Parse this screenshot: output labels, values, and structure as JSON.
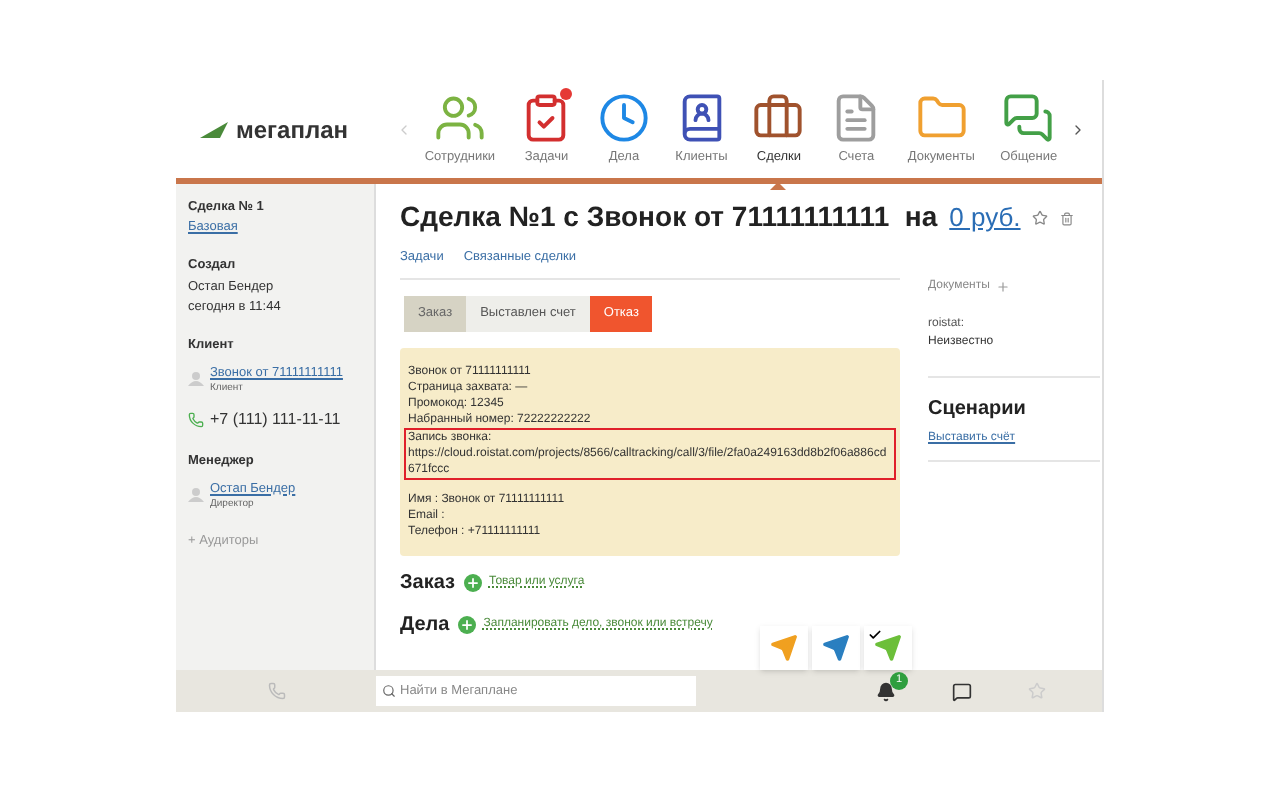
{
  "logo": {
    "text": "мегаплан"
  },
  "nav": [
    {
      "kind": "staff",
      "label": "Сотрудники",
      "selected": false,
      "alert": false
    },
    {
      "kind": "tasks",
      "label": "Задачи",
      "selected": false,
      "alert": true
    },
    {
      "kind": "clock",
      "label": "Дела",
      "selected": false,
      "alert": false
    },
    {
      "kind": "contacts",
      "label": "Клиенты",
      "selected": false,
      "alert": false
    },
    {
      "kind": "deals",
      "label": "Сделки",
      "selected": true,
      "alert": false
    },
    {
      "kind": "invoice",
      "label": "Счета",
      "selected": false,
      "alert": false
    },
    {
      "kind": "folder",
      "label": "Документы",
      "selected": false,
      "alert": false
    },
    {
      "kind": "chat",
      "label": "Общение",
      "selected": false,
      "alert": false
    }
  ],
  "sidebar": {
    "deal_title": "Сделка № 1",
    "deal_type": "Базовая",
    "created_label": "Создал",
    "created_by": "Остап Бендер",
    "created_at": "сегодня в 11:44",
    "client_label": "Клиент",
    "client_name": "Звонок от 71111111111",
    "client_role": "Клиент",
    "client_phone": "+7 (111) 111-11-11",
    "manager_label": "Менеджер",
    "manager_name": "Остап Бендер",
    "manager_role": "Директор",
    "auditors": "+ Аудиторы"
  },
  "deal": {
    "title": "Сделка №1 с Звонок от 71111111111  на",
    "amount": "0 руб."
  },
  "tabs": [
    {
      "label": "Задачи"
    },
    {
      "label": "Связанные сделки"
    }
  ],
  "stages": [
    {
      "label": "Заказ",
      "done": true,
      "selected": false
    },
    {
      "label": "Выставлен счет",
      "done": false,
      "selected": false
    },
    {
      "label": "Отказ",
      "done": false,
      "selected": true
    }
  ],
  "note": {
    "lines_before": [
      "Звонок от 71111111111",
      "Страница захвата: —",
      "Промокод: 12345",
      "Набранный номер: 72222222222"
    ],
    "highlight": [
      "Запись звонка:",
      "https://cloud.roistat.com/projects/8566/calltracking/call/3/file/2fa0a249163dd8b2f06a886cd671fccc"
    ],
    "lines_after": [
      "Имя : Звонок от 71111111111",
      "Email :",
      "Телефон : +71111111111"
    ]
  },
  "order": {
    "title": "Заказ",
    "action": "Товар или услуга"
  },
  "tasks": {
    "title": "Дела",
    "action": "Запланировать дело, звонок или встречу"
  },
  "planes": [
    {
      "color": "#f0a020",
      "selected": false
    },
    {
      "color": "#2a7fc0",
      "selected": false
    },
    {
      "color": "#6cbf3a",
      "selected": true
    }
  ],
  "right": {
    "docs_label": "Документы",
    "source_label": "roistat:",
    "source_value": "Неизвестно",
    "scenarios_title": "Сценарии",
    "scenario_link": "Выставить счёт"
  },
  "bottom": {
    "search_placeholder": "Найти в Мегаплане",
    "notifications": "1"
  }
}
